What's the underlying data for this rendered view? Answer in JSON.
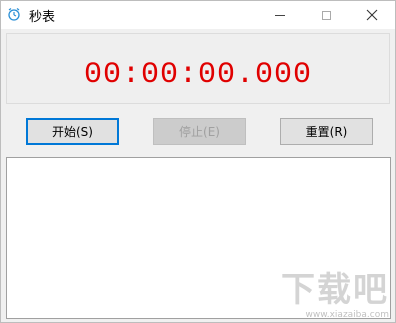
{
  "window": {
    "title": "秒表",
    "app_icon": "alarm-clock-icon",
    "controls": {
      "minimize": "minimize-icon",
      "maximize": "maximize-icon",
      "close": "close-icon"
    }
  },
  "display": {
    "time": "00:00:00.000",
    "color": "#e00000"
  },
  "buttons": {
    "start_label": "开始(S)",
    "stop_label": "停止(E)",
    "reset_label": "重置(R)"
  },
  "watermark": {
    "logo": "下载吧",
    "url": "www.xiazaiba.com"
  },
  "colors": {
    "accent": "#0078d7",
    "background": "#f0f0f0"
  }
}
